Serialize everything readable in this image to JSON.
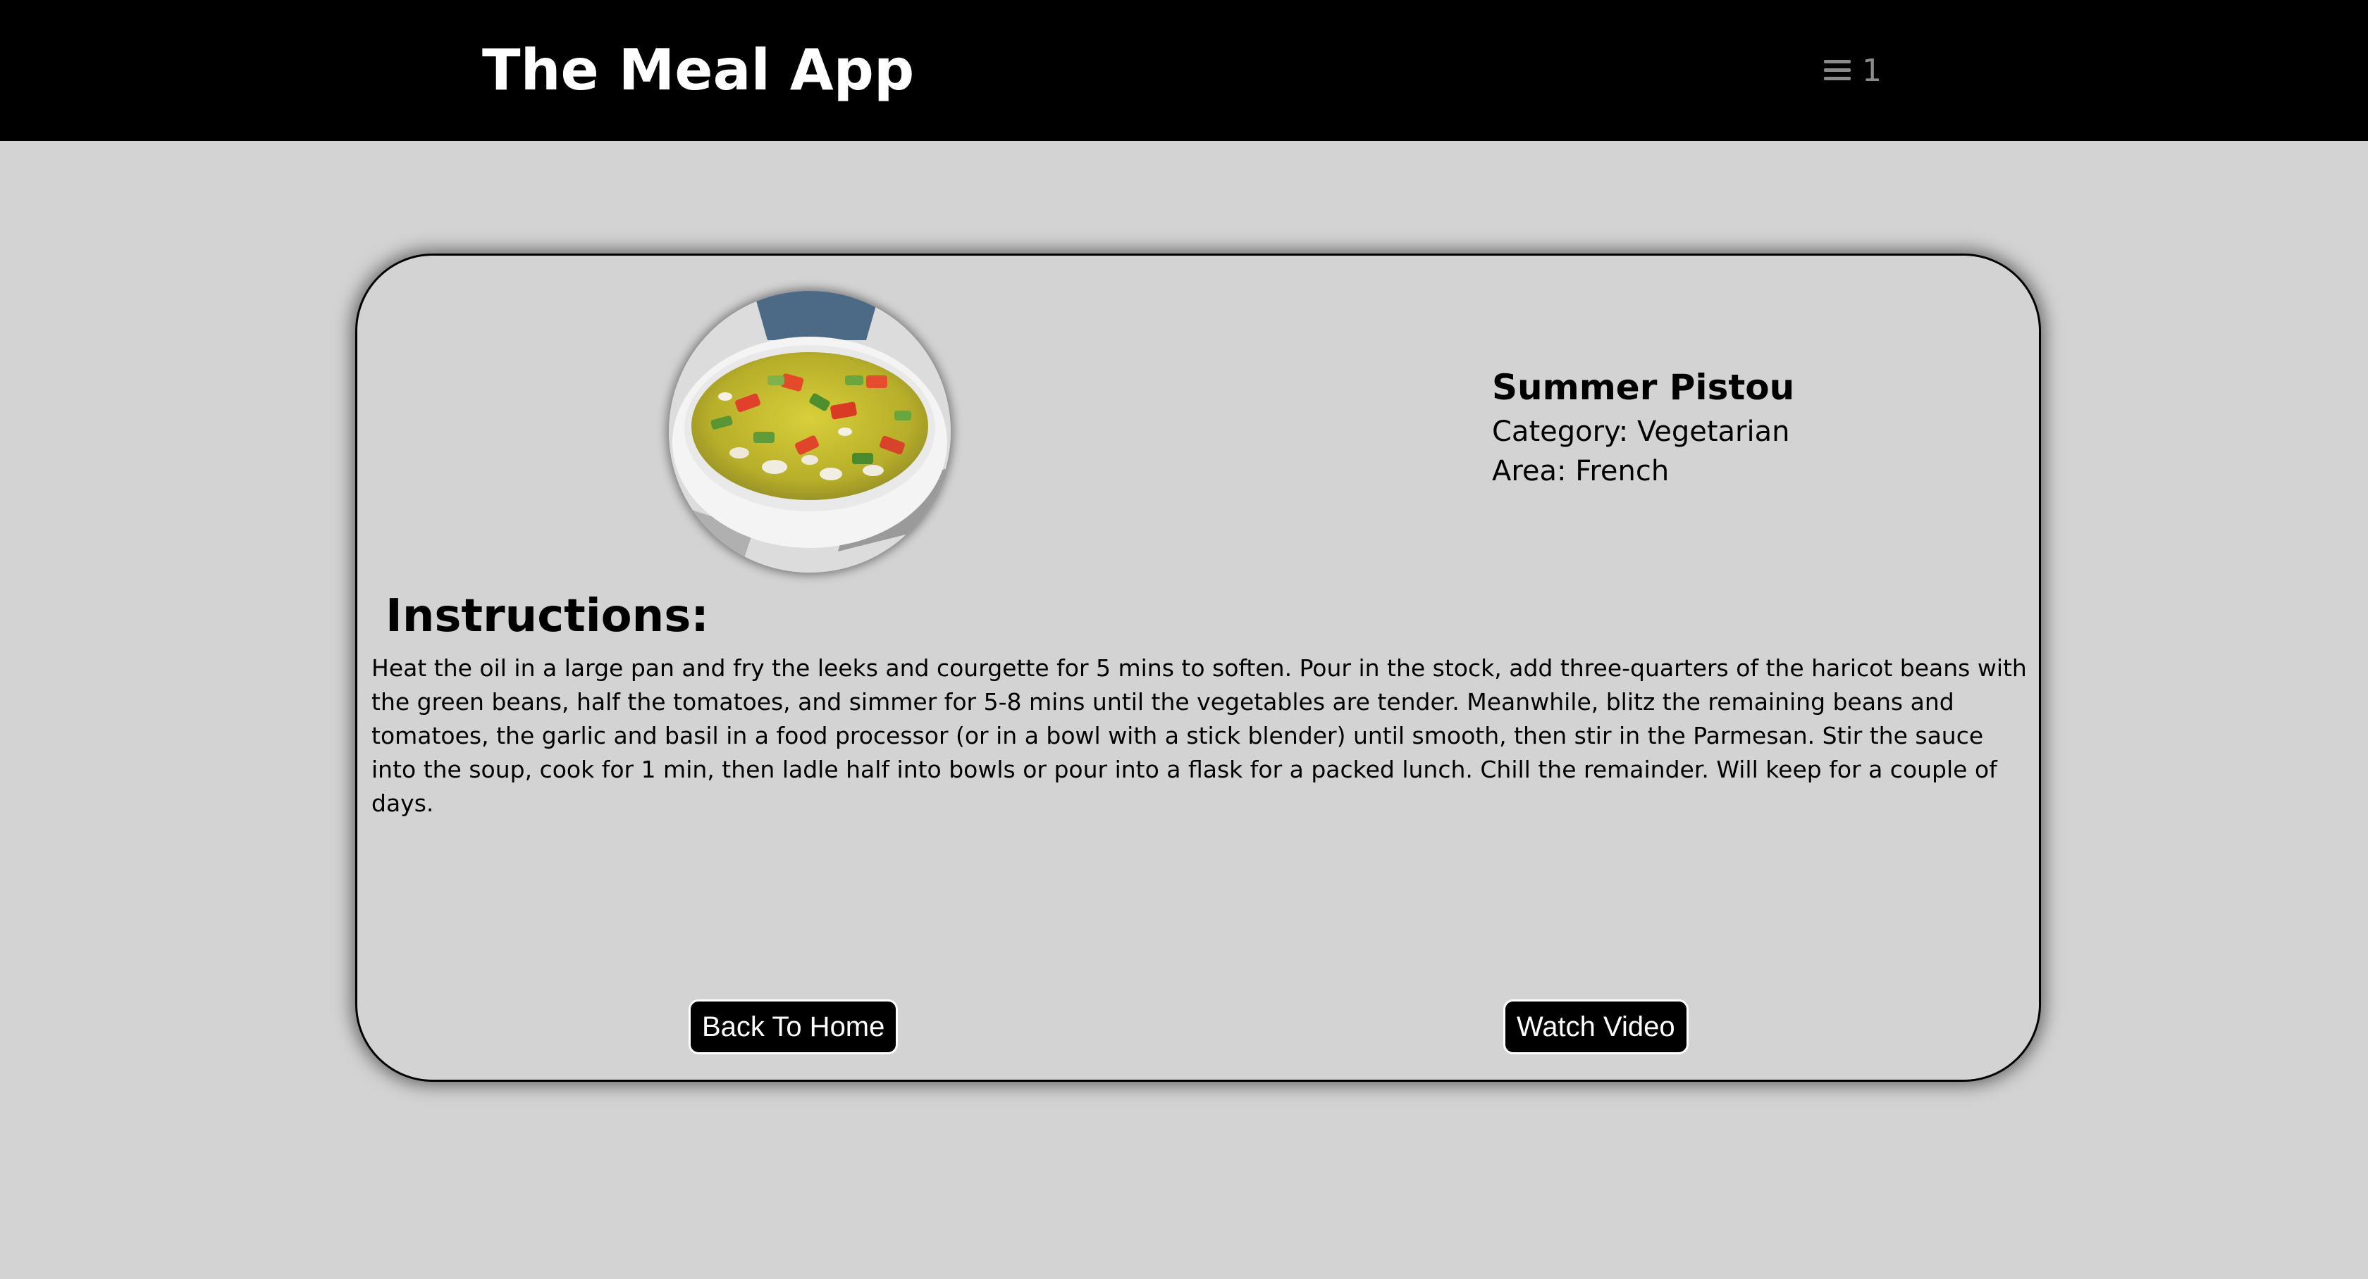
{
  "header": {
    "app_title": "The Meal App",
    "favourites_icon": "menu-icon",
    "favourites_count": "1"
  },
  "meal": {
    "image_alt": "Summer Pistou",
    "name": "Summer Pistou",
    "category": "Category: Vegetarian",
    "area": "Area: French",
    "instructions_heading": "Instructions:",
    "instructions": "Heat the oil in a large pan and fry the leeks and courgette for 5 mins to soften. Pour in the stock, add three-quarters of the haricot beans with the green beans, half the tomatoes, and simmer for 5-8 mins until the vegetables are tender. Meanwhile, blitz the remaining beans and tomatoes, the garlic and basil in a food processor (or in a bowl with a stick blender) until smooth, then stir in the Parmesan. Stir the sauce into the soup, cook for 1 min, then ladle half into bowls or pour into a flask for a packed lunch. Chill the remainder. Will keep for a couple of days."
  },
  "actions": {
    "back_home_label": "Back To Home",
    "watch_video_label": "Watch Video"
  },
  "colors": {
    "header_bg": "#000000",
    "page_bg": "#d3d3d3",
    "button_bg": "#000000",
    "button_text": "#ffffff",
    "muted_icon": "#8a8a8a"
  }
}
